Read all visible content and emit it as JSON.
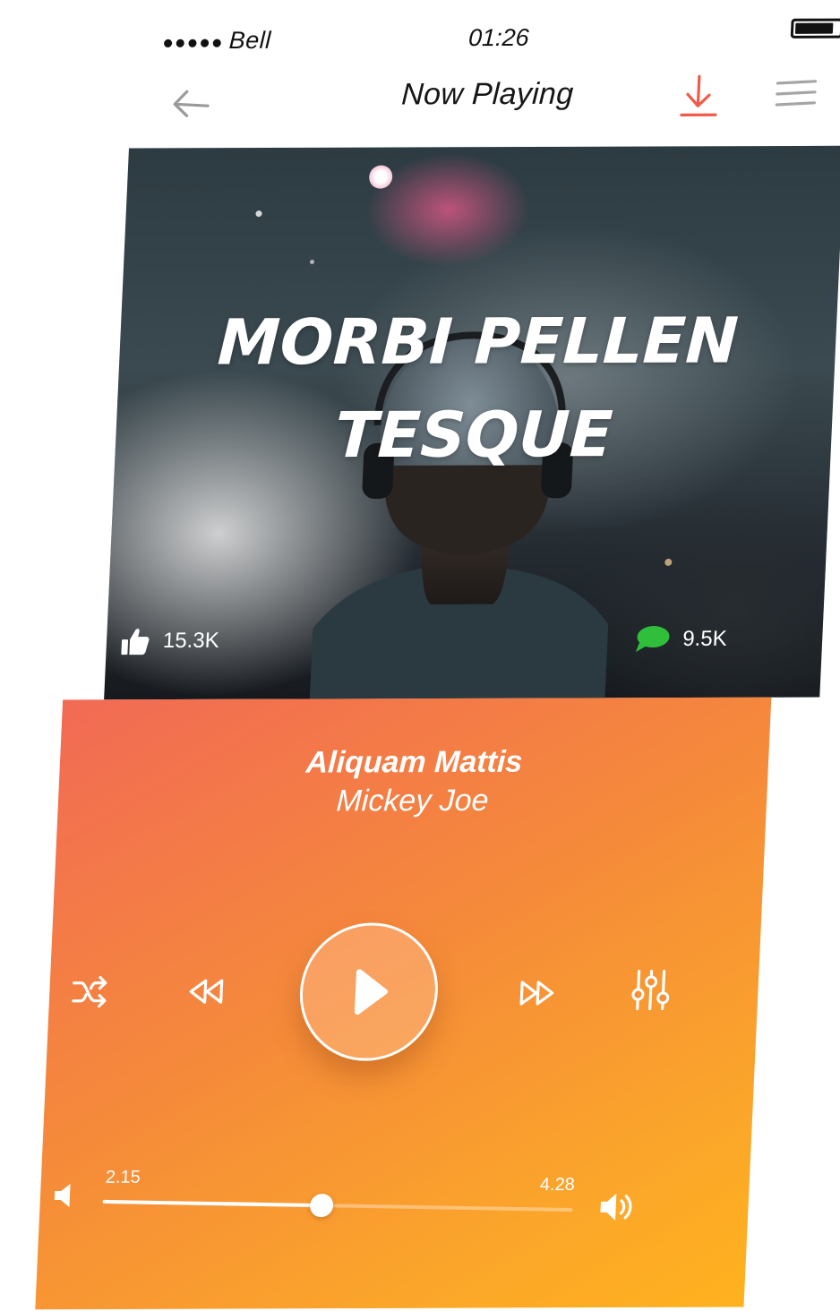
{
  "status_bar": {
    "signal_dots": "●●●●●",
    "carrier": "Bell",
    "time": "01:26",
    "battery_icon": "battery-full-icon"
  },
  "navbar": {
    "back_icon": "arrow-left-icon",
    "title": "Now Playing",
    "download_icon": "download-icon",
    "menu_icon": "hamburger-menu-icon",
    "accent_color": "#f05a4a"
  },
  "album": {
    "title": "MORBI PELLEN TESQUE",
    "likes_icon": "thumbs-up-icon",
    "likes_count": "15.3K",
    "comments_icon": "chat-bubble-icon",
    "comments_count": "9.5K",
    "comments_icon_color": "#2fbf3a"
  },
  "track": {
    "name": "Aliquam Mattis",
    "artist": "Mickey Joe"
  },
  "controls": {
    "shuffle_icon": "shuffle-icon",
    "rewind_icon": "rewind-icon",
    "play_icon": "play-icon",
    "forward_icon": "fast-forward-icon",
    "equalizer_icon": "equalizer-sliders-icon"
  },
  "progress": {
    "elapsed": "2.15",
    "total": "4.28",
    "fraction": 0.465,
    "volume_low_icon": "volume-low-icon",
    "volume_high_icon": "volume-high-icon"
  },
  "colors": {
    "player_gradient_start": "#f26a55",
    "player_gradient_end": "#ffb21e",
    "text_light": "#ffffff"
  }
}
